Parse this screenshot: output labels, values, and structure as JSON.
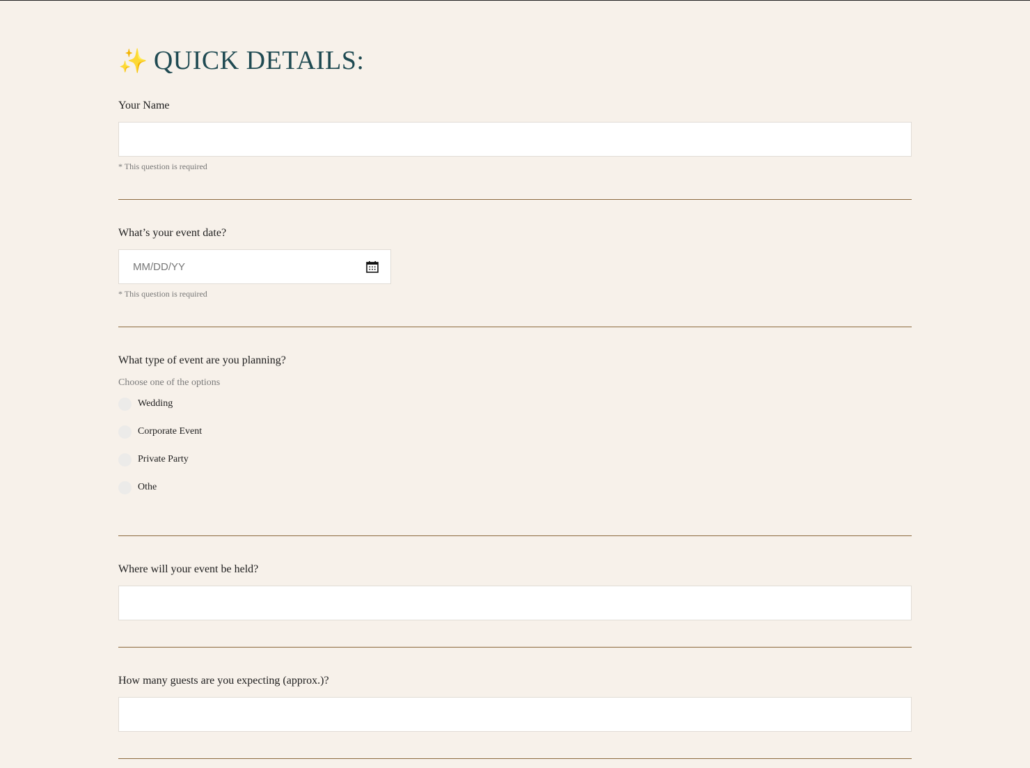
{
  "page": {
    "heading_icon": "sparkles-icon",
    "heading_icon_glyph": "✨",
    "heading": "QUICK DETAILS:"
  },
  "fields": {
    "name": {
      "label": "Your Name",
      "value": "",
      "required_note": "* This question is required"
    },
    "event_date": {
      "label": "What’s your event date?",
      "value": "",
      "placeholder": "MM/DD/YY",
      "icon": "calendar-icon",
      "required_note": "* This question is required"
    },
    "event_type": {
      "label": "What type of event are you planning?",
      "hint": "Choose one of the options",
      "options": [
        "Wedding",
        "Corporate Event",
        "Private Party",
        "Othe"
      ],
      "selected": null
    },
    "location": {
      "label": "Where will your event be held?",
      "value": ""
    },
    "guests": {
      "label": "How many guests are you expecting (approx.)?",
      "value": ""
    }
  },
  "colors": {
    "background": "#f7f1ea",
    "heading": "#1f4a52",
    "accent": "#e8b83a",
    "divider": "#8c6a3e"
  }
}
